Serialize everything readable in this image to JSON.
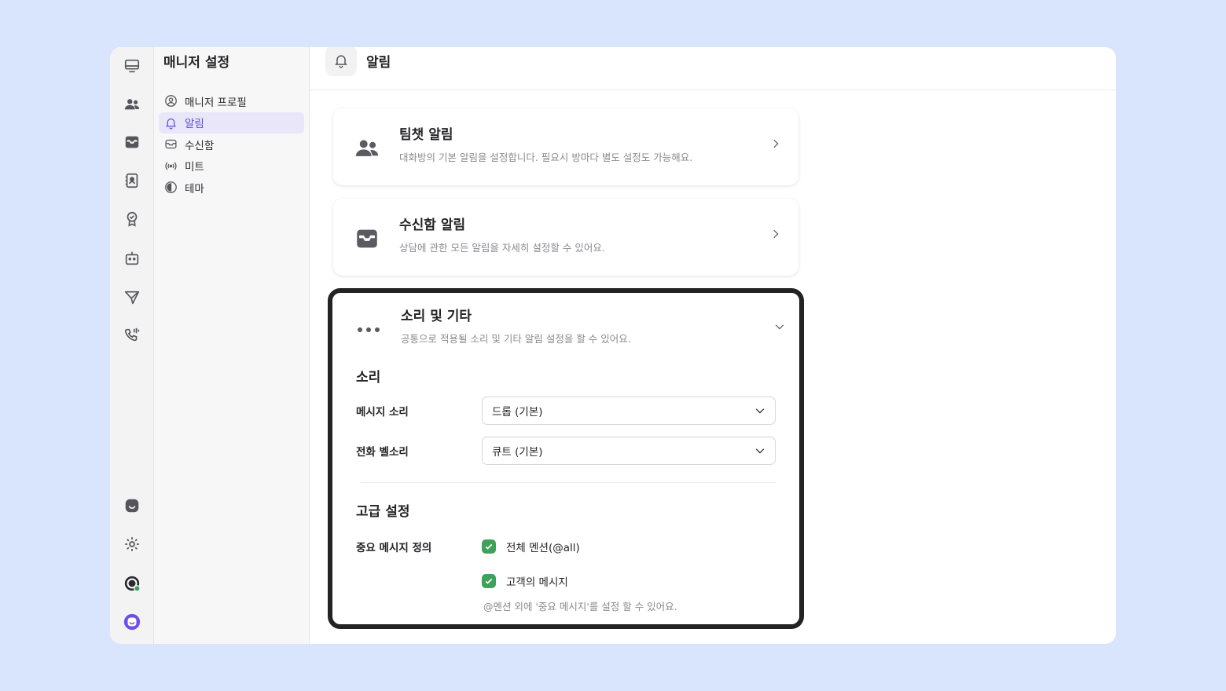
{
  "colors": {
    "accent": "#5e4fe0",
    "check_green": "#3fa15a",
    "page_bg": "#d9e5fd"
  },
  "rail": {
    "top_icons": [
      "monitor-icon",
      "team-icon",
      "inbox-icon",
      "contacts-icon",
      "badge-icon",
      "bot-icon",
      "send-icon",
      "phone-icon"
    ],
    "bottom_icons": [
      "channel-icon",
      "gear-icon",
      "profile-status-icon",
      "app-logo-icon"
    ]
  },
  "side": {
    "title": "매니저 설정",
    "items": [
      {
        "label": "매니저 프로필",
        "icon": "user-circle-icon"
      },
      {
        "label": "알림",
        "icon": "bell-icon"
      },
      {
        "label": "수신함",
        "icon": "inbox-icon"
      },
      {
        "label": "미트",
        "icon": "broadcast-icon"
      },
      {
        "label": "테마",
        "icon": "contrast-icon"
      }
    ],
    "active": "알림"
  },
  "header": {
    "title": "알림",
    "icon": "bell-icon"
  },
  "cards": {
    "teamchat": {
      "title": "팀챗 알림",
      "desc": "대화방의 기본 알림을 설정합니다. 필요시 방마다 별도 설정도 가능해요."
    },
    "inbox": {
      "title": "수신함 알림",
      "desc": "상담에 관한 모든 알림을 자세히 설정할 수 있어요."
    },
    "sound": {
      "title": "소리 및 기타",
      "desc": "공통으로 적용될 소리 및 기타 알림 설정을 할 수 있어요.",
      "sound_section": "소리",
      "message_sound_label": "메시지 소리",
      "message_sound_value": "드롭 (기본)",
      "ring_label": "전화 벨소리",
      "ring_value": "큐트 (기본)",
      "advanced_section": "고급 설정",
      "important_label": "중요 메시지 정의",
      "option_all": "전체 멘션(@all)",
      "option_all_checked": true,
      "option_customer": "고객의 메시지",
      "option_customer_checked": true,
      "hint": "@멘션 외에 '중요 메시지'를 설정 할 수 있어요."
    }
  }
}
